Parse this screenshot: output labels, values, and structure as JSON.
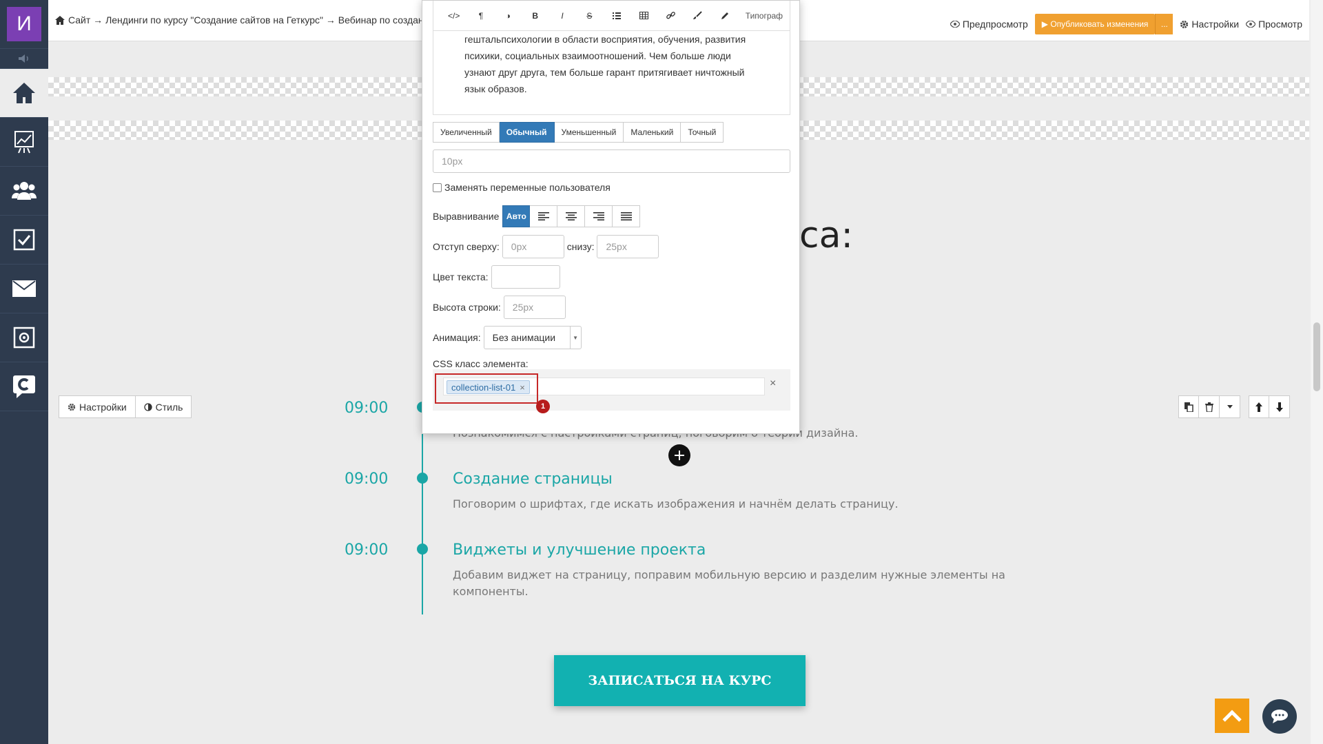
{
  "sidebar": {
    "logo": "И",
    "items": [
      {
        "icon": "home-icon"
      },
      {
        "icon": "chart-icon"
      },
      {
        "icon": "users-icon"
      },
      {
        "icon": "tasks-icon"
      },
      {
        "icon": "mail-icon"
      },
      {
        "icon": "settings-box-icon"
      },
      {
        "icon": "chat-c-icon"
      }
    ]
  },
  "topbar": {
    "breadcrumb": "Сайт → Лендинги по курсу \"Создание сайтов на Геткурс\" → Вебинар по создан",
    "preview": "Предпросмотр",
    "publish": "▶ Опубликовать изменения",
    "publish_more": "...",
    "settings": "Настройки",
    "view": "Просмотр"
  },
  "editor": {
    "toolbar_typograph": "Типограф",
    "text": "гештальпсихологии в области восприятия, обучения, развития психики, социальных взаимоотношений. Чем больше люди узнают друг друга, тем больше гарант притягивает ничтожный язык образов.",
    "size_tabs": [
      "Увеличенный",
      "Обычный",
      "Уменьшенный",
      "Маленький",
      "Точный"
    ],
    "active_size": "Обычный",
    "size_placeholder": "10px",
    "replace_vars_label": "Заменять переменные пользователя",
    "align_label": "Выравнивание",
    "align_auto": "Авто",
    "margin_top_label": "Отступ сверху:",
    "margin_top_placeholder": "0px",
    "margin_bottom_label": "снизу:",
    "margin_bottom_placeholder": "25px",
    "text_color_label": "Цвет текста:",
    "line_height_label": "Высота строки:",
    "line_height_placeholder": "25px",
    "animation_label": "Анимация:",
    "animation_value": "Без анимации",
    "css_class_label": "CSS класс элемента:",
    "css_tag": "collection-list-01",
    "badge": "1"
  },
  "page": {
    "title_fragment": "са:",
    "block_settings": "Настройки",
    "block_style": "Стиль",
    "timeline": [
      {
        "time": "09:00",
        "title": "",
        "desc": "Познакомимся с настройками страниц, поговорим о теории дизайна."
      },
      {
        "time": "09:00",
        "title": "Создание страницы",
        "desc": "Поговорим о шрифтах, где искать изображения и начнём делать страницу."
      },
      {
        "time": "09:00",
        "title": "Виджеты и улучшение проекта",
        "desc": "Добавим виджет на страницу, поправим мобильную версию и разделим нужные элементы на компоненты."
      }
    ],
    "cta": "ЗАПИСАТЬСЯ НА КУРС"
  },
  "colors": {
    "accent": "#1aa6a6",
    "publish": "#f0a030",
    "primary": "#337ab7",
    "sidebar": "#2e3b4e",
    "highlight": "#c62828"
  }
}
